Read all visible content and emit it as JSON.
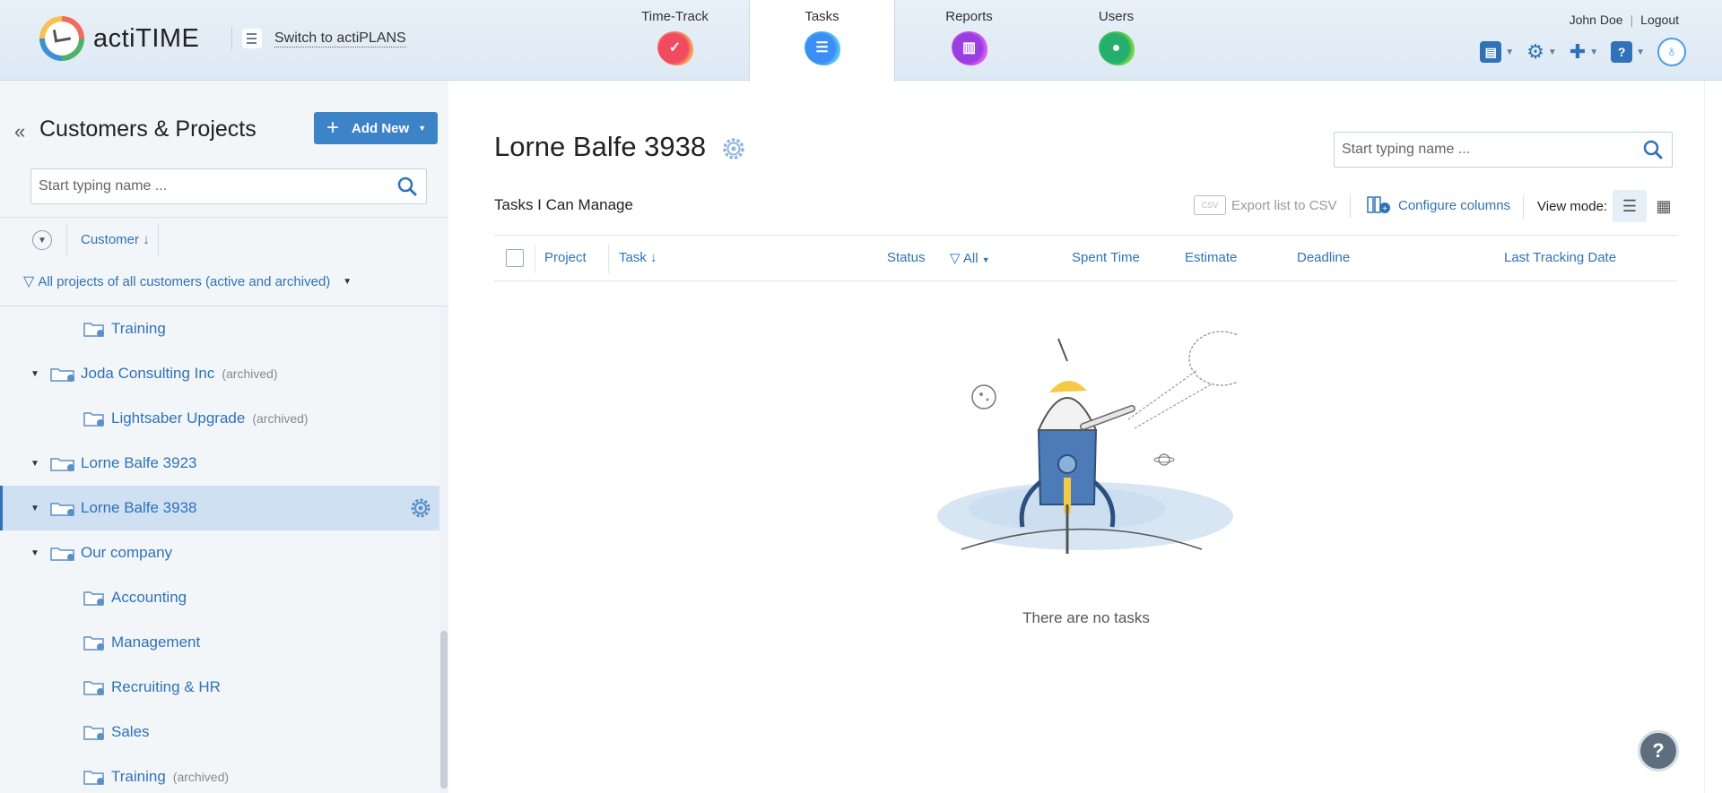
{
  "app": {
    "logo_text": "actiTIME",
    "switch_label": "Switch to actiPLANS"
  },
  "modules": [
    {
      "label": "Time-Track",
      "icon": "time-track-icon",
      "color": "#f04b61"
    },
    {
      "label": "Tasks",
      "icon": "tasks-icon",
      "color": "#3a8ef5",
      "active": true
    },
    {
      "label": "Reports",
      "icon": "reports-icon",
      "color": "#9a3ee0"
    },
    {
      "label": "Users",
      "icon": "users-icon",
      "color": "#24b06c"
    }
  ],
  "user": {
    "name": "John Doe",
    "sep": "|",
    "logout": "Logout"
  },
  "sidebar": {
    "title": "Customers & Projects",
    "add_new": "Add New",
    "search_placeholder": "Start typing name ...",
    "sort_label": "Customer",
    "filter_label": "All projects of all customers (active and archived)",
    "tree": [
      {
        "name": "Training",
        "level": 2,
        "archived": ""
      },
      {
        "name": "Joda Consulting Inc",
        "level": 1,
        "archived": "(archived)"
      },
      {
        "name": "Lightsaber Upgrade",
        "level": 2,
        "archived": "(archived)"
      },
      {
        "name": "Lorne Balfe 3923",
        "level": 1,
        "archived": ""
      },
      {
        "name": "Lorne Balfe 3938",
        "level": 1,
        "archived": "",
        "selected": true
      },
      {
        "name": "Our company",
        "level": 1,
        "archived": ""
      },
      {
        "name": "Accounting",
        "level": 2,
        "archived": ""
      },
      {
        "name": "Management",
        "level": 2,
        "archived": ""
      },
      {
        "name": "Recruiting & HR",
        "level": 2,
        "archived": ""
      },
      {
        "name": "Sales",
        "level": 2,
        "archived": ""
      },
      {
        "name": "Training",
        "level": 2,
        "archived": "(archived)"
      }
    ]
  },
  "main": {
    "title": "Lorne Balfe 3938",
    "search_placeholder": "Start typing name ...",
    "subhead": "Tasks I Can Manage",
    "export_label": "Export list to CSV",
    "csv_badge": "CSV",
    "configure_label": "Configure columns",
    "view_mode_label": "View mode:",
    "columns": {
      "project": "Project",
      "task": "Task",
      "status": "Status",
      "status_filter": "All",
      "spent_time": "Spent Time",
      "estimate": "Estimate",
      "deadline": "Deadline",
      "last_tracking": "Last Tracking Date"
    },
    "empty_text": "There are no tasks"
  },
  "colors": {
    "accent": "#2f72b8",
    "button": "#3d83c8",
    "selected_row": "#cfe0f3"
  }
}
